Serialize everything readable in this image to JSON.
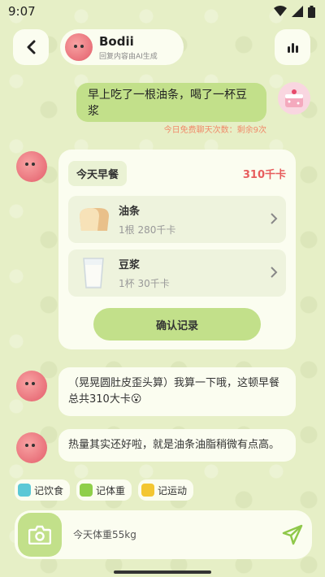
{
  "status_bar": {
    "time": "9:07"
  },
  "header": {
    "bot_name": "Bodii",
    "bot_subtitle": "回复内容由AI生成"
  },
  "chat": {
    "user_message": "早上吃了一根油条，喝了一杯豆浆",
    "quota_text": "今日免费聊天次数：剩余9次",
    "meal_card": {
      "title": "今天早餐",
      "total": "310千卡",
      "items": [
        {
          "name": "油条",
          "detail": "1根 280千卡",
          "icon": "bread-icon"
        },
        {
          "name": "豆浆",
          "detail": "1杯 30千卡",
          "icon": "soymilk-cup-icon"
        }
      ],
      "confirm_label": "确认记录"
    },
    "bot_messages": [
      "（晃晃圆肚皮歪头算）我算一下哦，这顿早餐总共310大卡😮",
      "热量其实还好啦，就是油条油脂稍微有点高。"
    ]
  },
  "quick_actions": [
    {
      "label": "记饮食",
      "color": "#5bc8d6"
    },
    {
      "label": "记体重",
      "color": "#8fcf4a"
    },
    {
      "label": "记运动",
      "color": "#f3c632"
    }
  ],
  "input": {
    "placeholder": "今天体重55kg"
  },
  "colors": {
    "accent": "#c2e08a",
    "background": "#e6efc6",
    "kcal_red": "#e75d5d",
    "quota_orange": "#f08a6a"
  }
}
